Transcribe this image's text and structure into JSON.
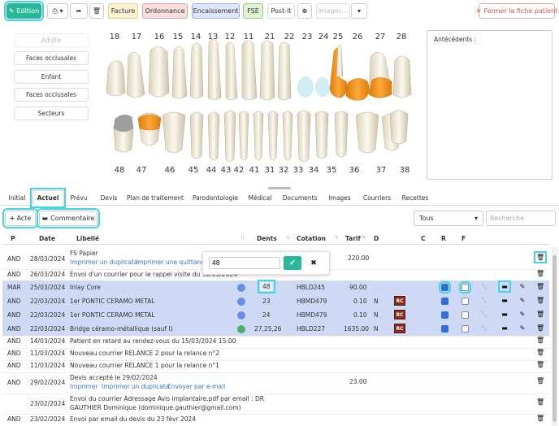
{
  "toolbar": {
    "edition": "Edition",
    "facture": "Facture",
    "ordonnance": "Ordonnance",
    "encaissement": "Encaissement",
    "fse": "FSE",
    "postit": "Post-it",
    "images_placeholder": "Images...",
    "close_patient": "Fermer la fiche patient"
  },
  "left_panel": {
    "adulte": "Adulte",
    "faces_occlusales_1": "Faces occlusales",
    "enfant": "Enfant",
    "faces_occlusales_2": "Faces occlusales",
    "secteurs": "Secteurs"
  },
  "antecedents_label": "Antécédents :",
  "teeth": {
    "upper_numbers": [
      "18",
      "17",
      "16",
      "15",
      "14",
      "13",
      "12",
      "11",
      "21",
      "22",
      "23",
      "24",
      "25",
      "26",
      "27",
      "28"
    ],
    "lower_numbers": [
      "48",
      "47",
      "46",
      "45",
      "44",
      "43",
      "42",
      "41",
      "31",
      "32",
      "33",
      "34",
      "35",
      "36",
      "37",
      "38"
    ],
    "colors": {
      "highlight": "#f08c10",
      "missing": "#cfeff5",
      "selected_gray": "#9e9e9e"
    }
  },
  "tabs": [
    "Initial",
    "Actuel",
    "Prévu",
    "Devis",
    "Plan de traitement",
    "Parodontologie",
    "Médical",
    "Documents",
    "Images",
    "Courriers",
    "Recettes"
  ],
  "actions": {
    "acte": "Acte",
    "commentaire": "Commentaire"
  },
  "filter": {
    "tous": "Tous",
    "search_placeholder": "Recherche"
  },
  "table": {
    "headers": {
      "p": "P",
      "date": "Date",
      "libelle": "Libellé",
      "dents": "Dents",
      "cotation": "Cotation",
      "tarif": "Tarif",
      "d": "D",
      "c": "C",
      "r": "R",
      "f": "F"
    },
    "rows": [
      {
        "p": "AND",
        "date": "28/03/2024",
        "libelle": "FS Papier",
        "link1": "Imprimer un duplicata",
        "link2": "Imprimer une quittance",
        "tarif": "220.00"
      },
      {
        "p": "AND",
        "date": "26/03/2024",
        "libelle": "Envoi d'un courrier pour le rappel visite du 31/03/2024"
      },
      {
        "p": "MAR",
        "date": "25/03/2024",
        "libelle": "Inlay Core",
        "dents": "48",
        "cotation": "HBLD245",
        "tarif": "90.00"
      },
      {
        "p": "AND",
        "date": "22/03/2024",
        "libelle": "1er PONTIC CERAMO METAL",
        "dents": "23",
        "cotation": "HBMD479",
        "tarif": "0.10",
        "d": "N",
        "rc": "RC"
      },
      {
        "p": "AND",
        "date": "22/03/2024",
        "libelle": "1er PONTIC CERAMO METAL",
        "dents": "24",
        "cotation": "HBMD479",
        "tarif": "0.10",
        "d": "N",
        "rc": "RC"
      },
      {
        "p": "AND",
        "date": "22/03/2024",
        "libelle": "Bridge céramo-métallique (sauf I)",
        "dents": "27,25,26",
        "cotation": "HBLD227",
        "tarif": "1635.00",
        "d": "N",
        "rc": "RC"
      },
      {
        "p": "AND",
        "date": "14/03/2024",
        "libelle": "Patient en retard au rendez-vous du 15/03/2024 15:00"
      },
      {
        "p": "AND",
        "date": "11/03/2024",
        "libelle": "Nouveau courrier RELANCE 2 pour la relance n°2"
      },
      {
        "p": "AND",
        "date": "11/03/2024",
        "libelle": "Nouveau courrier RELANCE 1 pour la relance n°1"
      },
      {
        "p": "AND",
        "date": "29/02/2024",
        "libelle": "Devis accepté le 29/02/2024",
        "link1": "Imprimer",
        "link2": "Imprimer un duplicata",
        "link3": "Envoyer par e-mail",
        "tarif": "23.00"
      },
      {
        "p": "",
        "date": "23/02/2024",
        "libelle": "Envoi du courrier Adressage Avis implantaire.pdf par email : DR",
        "libelle2": "GAUTHIER Dominique (dominique.gauthier@gmail.com)"
      },
      {
        "p": "AND",
        "date": "23/02/2024",
        "libelle": "Envoi par email du devis du 23 févr 2024"
      }
    ]
  },
  "popup": {
    "value": "48"
  }
}
